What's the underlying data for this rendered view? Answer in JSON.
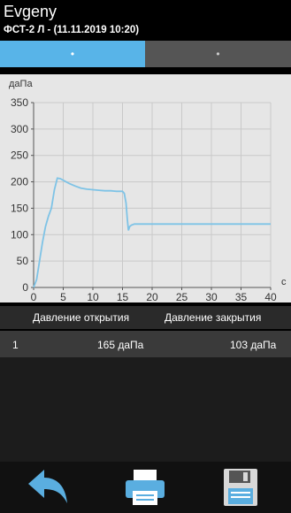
{
  "header": {
    "title": "Evgeny",
    "subtitle": "ФСТ-2 Л - (11.11.2019 10:20)"
  },
  "tabs": [
    {
      "label": "•",
      "active": true
    },
    {
      "label": "•",
      "active": false
    }
  ],
  "chart_data": {
    "type": "line",
    "ylabel": "даПа",
    "xlabel": "с",
    "xlim": [
      0,
      40
    ],
    "ylim": [
      0,
      350
    ],
    "x_ticks": [
      0,
      5,
      10,
      15,
      20,
      25,
      30,
      35,
      40
    ],
    "y_ticks": [
      0,
      50,
      100,
      150,
      200,
      250,
      300,
      350
    ],
    "grid": true,
    "line_color": "#7ec3e6",
    "series": [
      {
        "x": [
          0,
          0.5,
          1,
          1.5,
          2,
          2.5,
          3,
          3.5,
          4,
          4.5,
          5,
          6,
          7,
          8,
          9,
          10,
          11,
          12,
          13,
          14,
          15,
          15.3,
          15.6,
          15.8,
          16,
          16.2,
          16.5,
          17,
          20,
          25,
          30,
          35,
          40
        ],
        "y": [
          0,
          15,
          50,
          85,
          115,
          135,
          150,
          185,
          207,
          206,
          203,
          197,
          192,
          188,
          186,
          185,
          184,
          183,
          183,
          182,
          182,
          178,
          160,
          130,
          108,
          115,
          118,
          120,
          120,
          120,
          120,
          120,
          120
        ]
      }
    ]
  },
  "table": {
    "columns": [
      "Давление открытия",
      "Давление закрытия"
    ],
    "rows": [
      {
        "index": "1",
        "open": "165 даПа",
        "close": "103 даПа"
      }
    ]
  },
  "toolbar": {
    "back_icon": "back-arrow-icon",
    "print_icon": "printer-icon",
    "save_icon": "floppy-disk-icon",
    "accent": "#58b4e8"
  }
}
